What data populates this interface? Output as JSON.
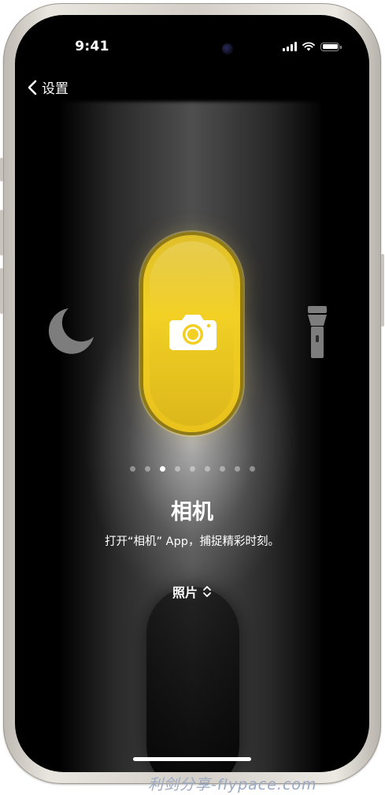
{
  "status_bar": {
    "time": "9:41"
  },
  "nav": {
    "back_label": "设置"
  },
  "action": {
    "current_icon": "camera-icon",
    "left_icon": "moon-icon",
    "right_icon": "flashlight-icon",
    "accent_color": "#F2CF22",
    "page_count": 9,
    "active_page": 3,
    "title": "相机",
    "description": "打开“相机” App，捕捉精彩时刻。"
  },
  "picker": {
    "value": "照片",
    "icon": "chevron-up-down-icon"
  },
  "watermark": "利剑分享-flypace.com"
}
